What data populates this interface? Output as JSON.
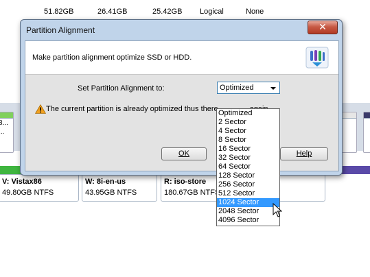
{
  "background": {
    "table_row": [
      "51.82GB",
      "26.41GB",
      "25.42GB",
      "Logical",
      "None"
    ],
    "partitions": [
      {
        "name": "V: Vistax86",
        "size": "49.80GB NTFS",
        "color": "#3fb53f"
      },
      {
        "name": "W: 8i-en-us",
        "size": "43.95GB NTFS",
        "color": "#3fb53f"
      },
      {
        "name": "R: iso-store",
        "size": "180.67GB NTFS",
        "color": "#3fb53f"
      },
      {
        "name": "",
        "size": "",
        "color": "#5a4aa8"
      }
    ],
    "left_tile_label": "8...",
    "left_tile_sub": "..."
  },
  "dialog": {
    "title": "Partition Alignment",
    "close_label": "✕",
    "header_text": "Make partition alignment optimize SSD or HDD.",
    "set_label": "Set Partition Alignment to:",
    "selected_value": "Optimized",
    "warning_text": "The current partition is already optimized thus there",
    "warning_text_tail": "again.",
    "ok_label": "OK",
    "help_label": "Help"
  },
  "dropdown": {
    "options": [
      "Optimized",
      "2 Sector",
      "4 Sector",
      "8 Sector",
      "16 Sector",
      "32 Sector",
      "64 Sector",
      "128 Sector",
      "256 Sector",
      "512 Sector",
      "1024 Sector",
      "2048 Sector",
      "4096 Sector"
    ],
    "highlighted_index": 10
  },
  "colors": {
    "accent": "#3399ff",
    "dialog_frame": "#c0d4ea",
    "close_button": "#c75a45"
  },
  "icons": [
    "app-icon",
    "warning-icon",
    "close-icon",
    "chevron-down-icon",
    "cursor-icon"
  ]
}
